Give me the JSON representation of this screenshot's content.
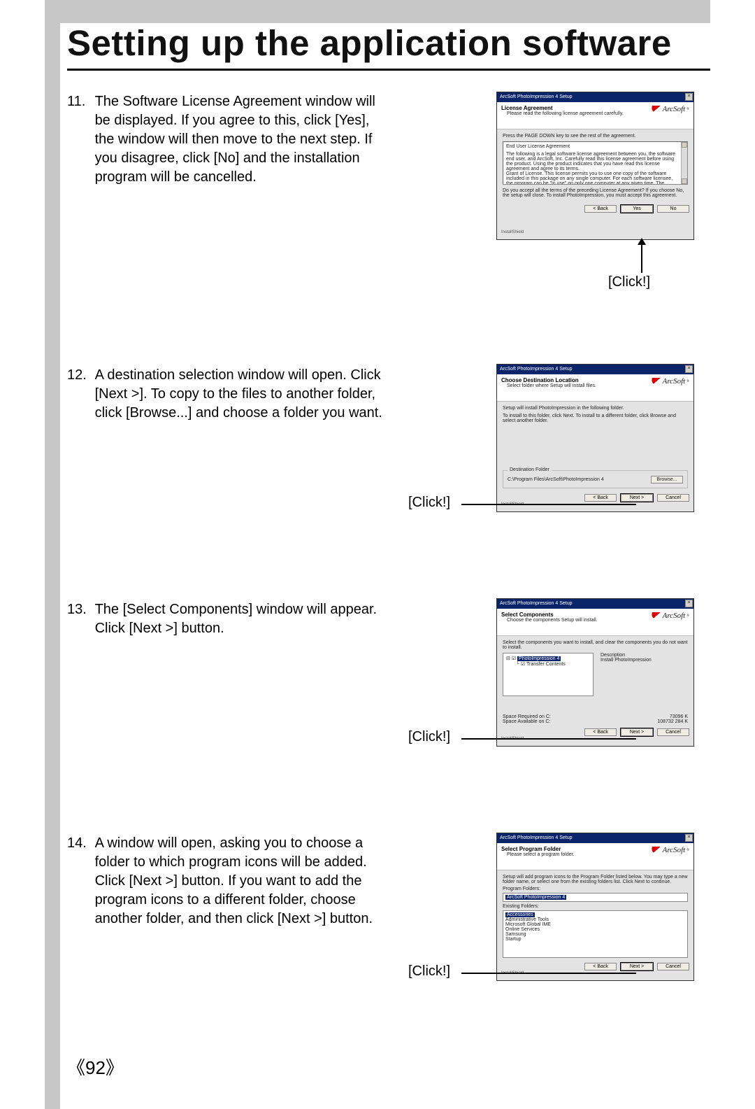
{
  "title": "Setting up the application software",
  "page_number": "《92》",
  "click_label": "[Click!]",
  "steps": [
    {
      "num": "11.",
      "text": "The Software License Agreement window will be displayed. If you agree to this, click [Yes], the window will then move to the next step. If you disagree, click [No] and the installation program will be cancelled."
    },
    {
      "num": "12.",
      "text": "A destination selection window will open. Click [Next >]. To copy to the files to another folder, click [Browse...] and choose a folder you want."
    },
    {
      "num": "13.",
      "text": "The [Select Components] window will appear. Click [Next >] button."
    },
    {
      "num": "14.",
      "text": "A window will open, asking you to choose a folder to which program icons will be added. Click [Next >] button. If you want to add the program icons to a different folder, choose another folder, and then click [Next >] button."
    }
  ],
  "installshield": "InstallShield",
  "buttons": {
    "back": "< Back",
    "yes": "Yes",
    "no": "No",
    "next": "Next >",
    "cancel": "Cancel",
    "browse": "Browse..."
  },
  "dlg_common": {
    "title_bar": "ArcSoft PhotoImpression 4 Setup",
    "brand": "ArcSoft"
  },
  "dlg1": {
    "h": "License Agreement",
    "sub": "Please read the following license agreement carefully.",
    "scroll_hint": "Press the PAGE DOWN key to see the rest of the agreement.",
    "eula_head": "End User License Agreement",
    "eula_body": "The following is a legal software license agreement between you, the software end user, and ArcSoft, Inc. Carefully read this license agreement before using the product. Using the product indicates that you have read this license agreement and agree to its terms.\nGrant of License. This license permits you to use one copy of the software included in this package on any single computer. For each software licensee, the program can be \"in use\" on only one computer at any given time. The software is \"in use\" when it is either",
    "accept": "Do you accept all the terms of the preceding License Agreement? If you choose No, the setup will close. To install PhotoImpression, you must accept this agreement."
  },
  "dlg2": {
    "h": "Choose Destination Location",
    "sub": "Select folder where Setup will install files.",
    "line1": "Setup will install PhotoImpression in the following folder.",
    "line2": "To install to this folder, click Next. To install to a different folder, click Browse and select another folder.",
    "dest_caption": "Destination Folder",
    "dest_path": "C:\\Program Files\\ArcSoft\\PhotoImpression 4"
  },
  "dlg3": {
    "h": "Select Components",
    "sub": "Choose the components Setup will install.",
    "line1": "Select the components you want to install, and clear the components you do not want to install.",
    "tree": {
      "root": "PhotoImpression 4",
      "child": "Transfer Contents"
    },
    "desc_label": "Description",
    "desc_text": "Install PhotoImpression",
    "space_req_label": "Space Required on C:",
    "space_req_val": "73096 K",
    "space_avail_label": "Space Available on C:",
    "space_avail_val": "108732 284 K"
  },
  "dlg4": {
    "h": "Select Program Folder",
    "sub": "Please select a program folder.",
    "line1": "Setup will add program icons to the Program Folder listed below. You may type a new folder name, or select one from the existing folders list. Click Next to continue.",
    "prog_label": "Program Folders:",
    "prog_value": "ArcSoft PhotoImpression 4",
    "exist_label": "Existing Folders:",
    "folders": [
      "Accessories",
      "Administrative Tools",
      "Microsoft Global IME",
      "Online Services",
      "Samsung",
      "Startup"
    ]
  }
}
